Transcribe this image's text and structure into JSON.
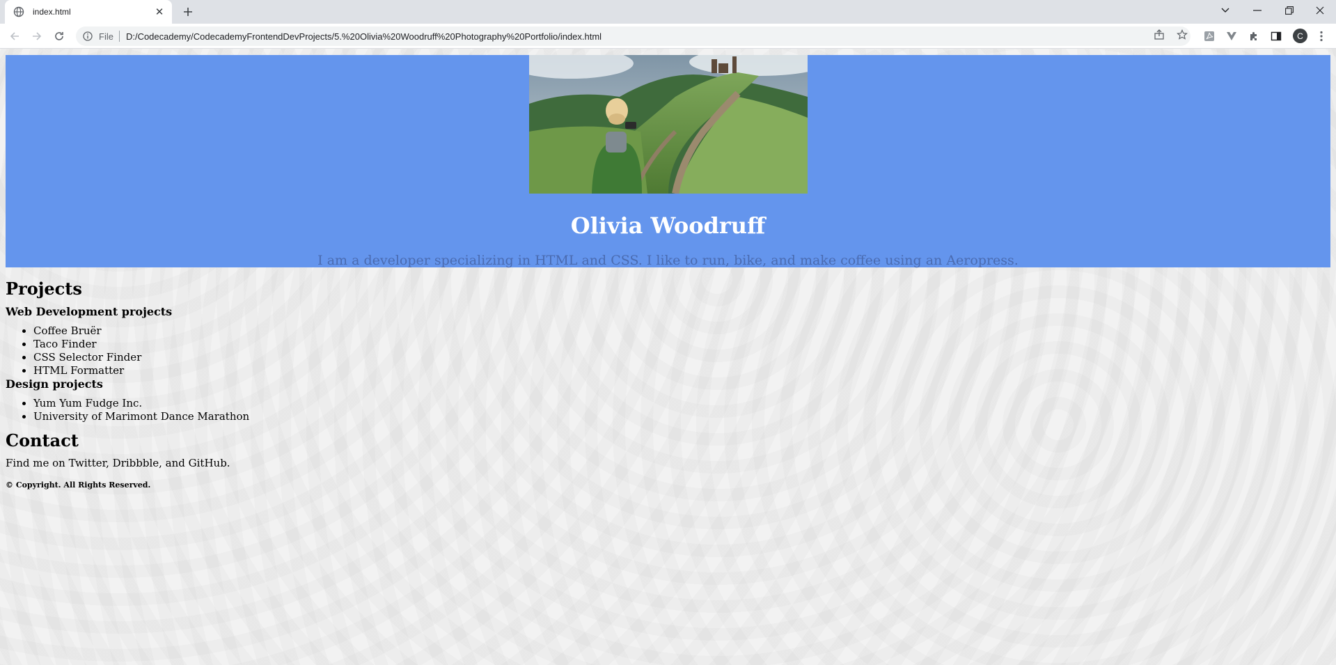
{
  "browser": {
    "tab_title": "index.html",
    "url_scheme": "File",
    "url": "D:/Codecademy/CodecademyFrontendDevProjects/5.%20Olivia%20Woodruff%20Photography%20Portfolio/index.html",
    "profile_initial": "C"
  },
  "header": {
    "name": "Olivia Woodruff",
    "bio": "I am a developer specializing in HTML and CSS. I like to run, bike, and make coffee using an Aeropress."
  },
  "projects": {
    "heading": "Projects",
    "web": {
      "heading": "Web Development projects",
      "items": [
        "Coffee Bruër",
        "Taco Finder",
        "CSS Selector Finder",
        "HTML Formatter"
      ]
    },
    "design": {
      "heading": "Design projects",
      "items": [
        "Yum Yum Fudge Inc.",
        "University of Marimont Dance Marathon"
      ]
    }
  },
  "contact": {
    "heading": "Contact",
    "text": "Find me on Twitter, Dribbble, and GitHub."
  },
  "footer": {
    "copyright": "© Copyright. All Rights Reserved."
  },
  "colors": {
    "header_bg": "#6495ed",
    "name_text": "#ffffff",
    "bio_text": "#4a6bb0",
    "tabstrip_bg": "#dee1e6"
  },
  "icons": {
    "tab_favicon": "globe-icon",
    "new_tab": "plus-icon",
    "back": "arrow-left-icon",
    "forward": "arrow-right-icon",
    "reload": "reload-icon",
    "site_info": "info-icon",
    "share": "share-icon",
    "bookmark": "star-icon",
    "extensions": "puzzle-icon",
    "side_panel": "side-panel-icon",
    "menu": "kebab-menu-icon"
  }
}
